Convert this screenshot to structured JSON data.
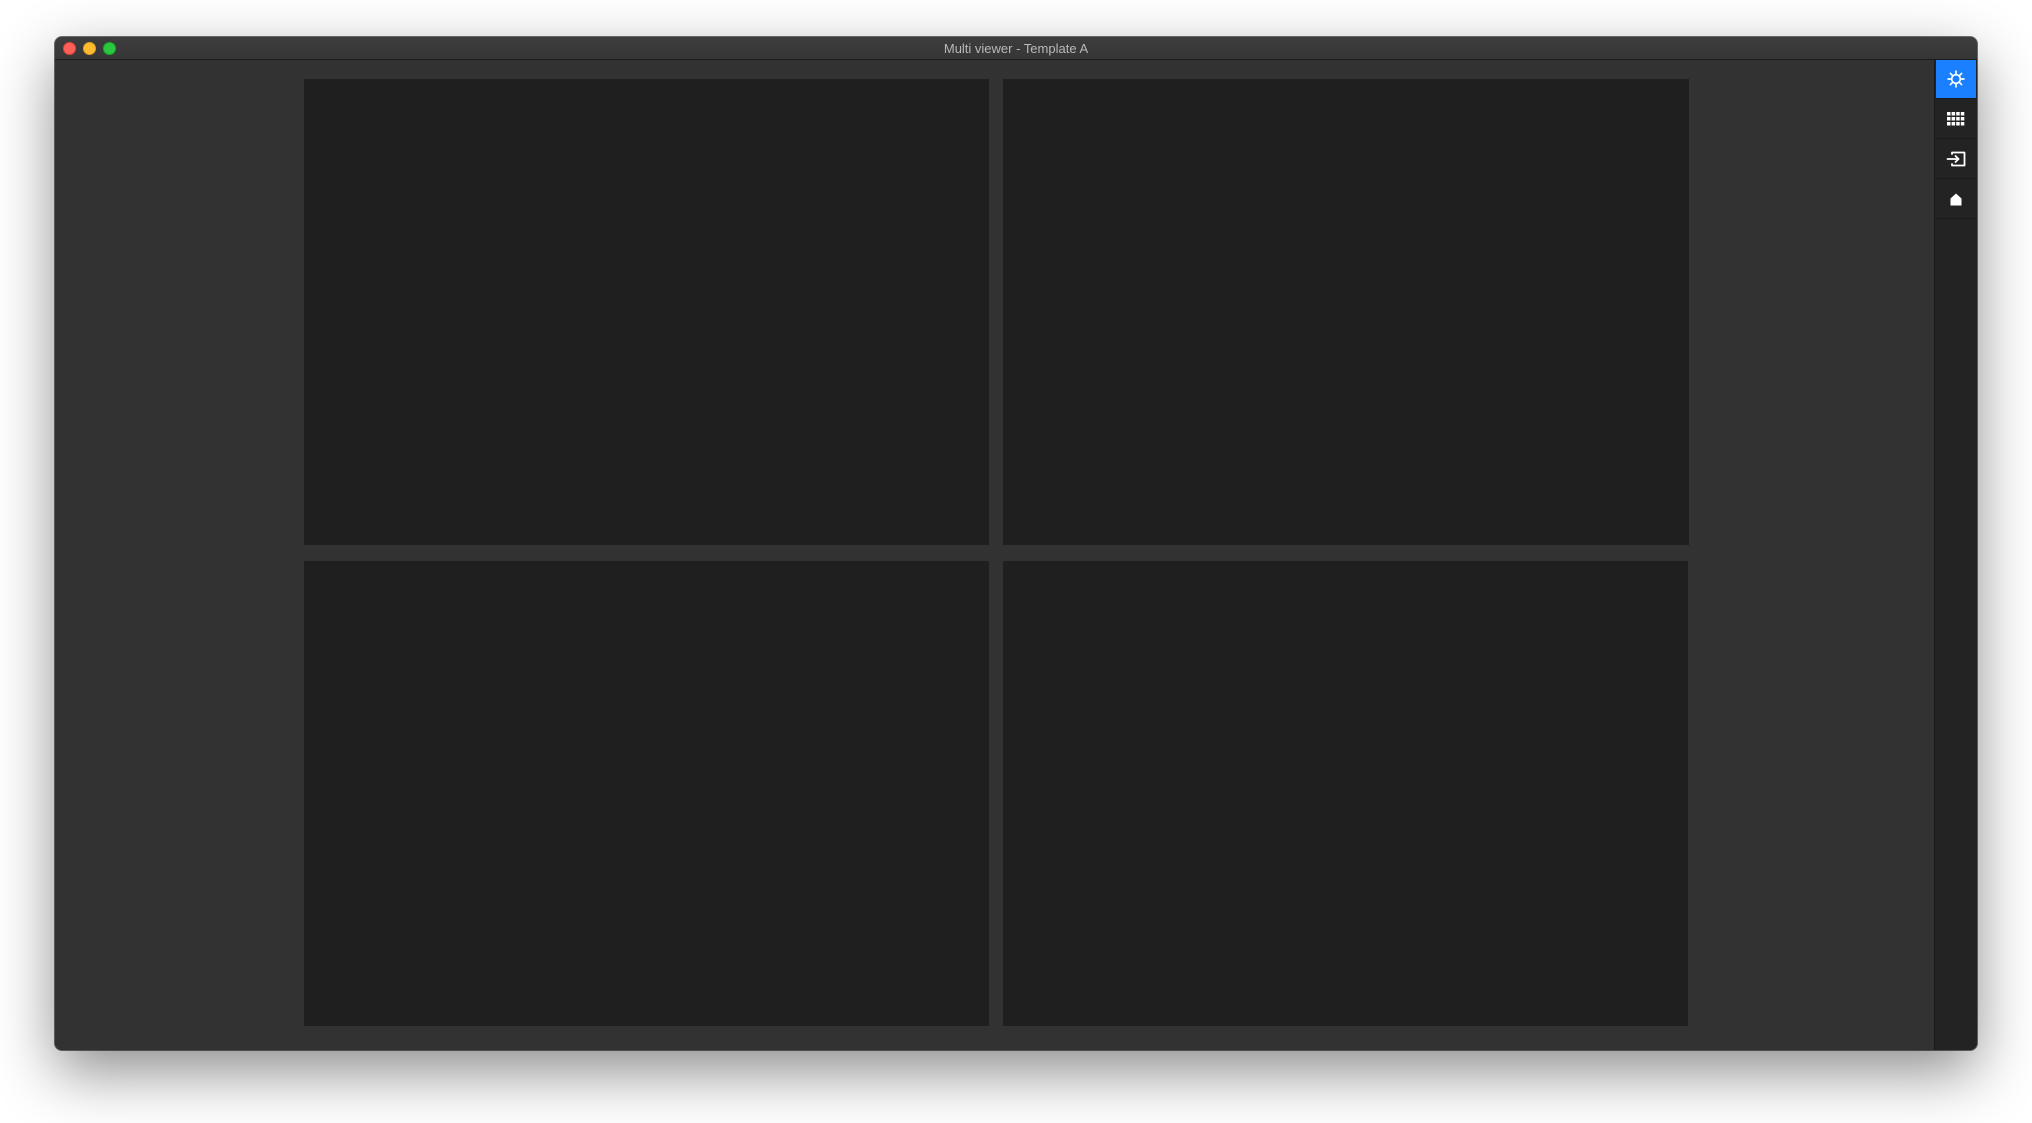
{
  "window": {
    "title": "Multi viewer - Template A"
  },
  "viewer": {
    "layout": "2x2",
    "panels": [
      "panel-1",
      "panel-2",
      "panel-3",
      "panel-4"
    ]
  },
  "sidebar": {
    "buttons": [
      {
        "icon": "gear-icon",
        "active": true
      },
      {
        "icon": "grid-icon",
        "active": false
      },
      {
        "icon": "input-icon",
        "active": false
      },
      {
        "icon": "home-icon",
        "active": false
      }
    ],
    "accent_color": "#1b80ff"
  }
}
